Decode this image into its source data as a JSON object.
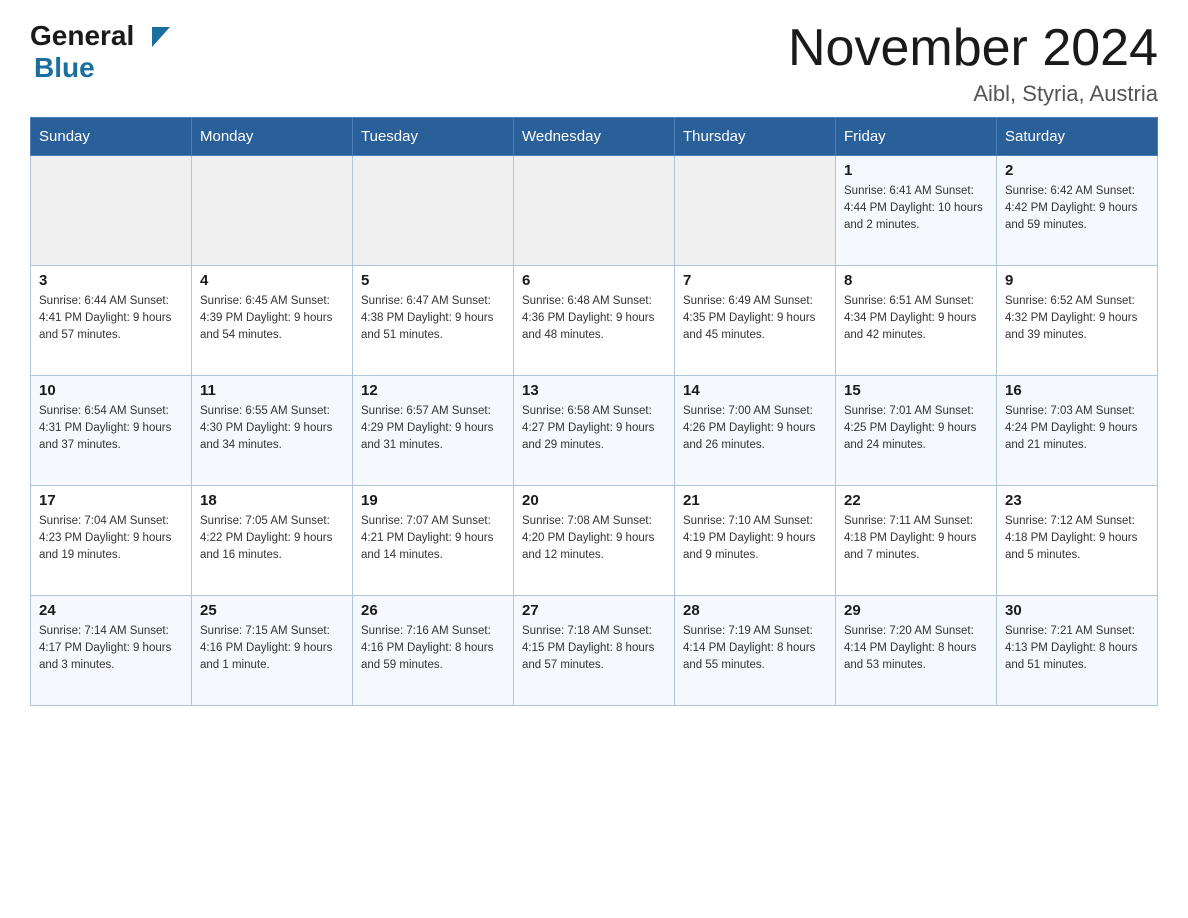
{
  "header": {
    "logo_general": "General",
    "logo_blue": "Blue",
    "title": "November 2024",
    "subtitle": "Aibl, Styria, Austria"
  },
  "weekdays": [
    "Sunday",
    "Monday",
    "Tuesday",
    "Wednesday",
    "Thursday",
    "Friday",
    "Saturday"
  ],
  "weeks": [
    [
      {
        "day": "",
        "info": ""
      },
      {
        "day": "",
        "info": ""
      },
      {
        "day": "",
        "info": ""
      },
      {
        "day": "",
        "info": ""
      },
      {
        "day": "",
        "info": ""
      },
      {
        "day": "1",
        "info": "Sunrise: 6:41 AM\nSunset: 4:44 PM\nDaylight: 10 hours\nand 2 minutes."
      },
      {
        "day": "2",
        "info": "Sunrise: 6:42 AM\nSunset: 4:42 PM\nDaylight: 9 hours\nand 59 minutes."
      }
    ],
    [
      {
        "day": "3",
        "info": "Sunrise: 6:44 AM\nSunset: 4:41 PM\nDaylight: 9 hours\nand 57 minutes."
      },
      {
        "day": "4",
        "info": "Sunrise: 6:45 AM\nSunset: 4:39 PM\nDaylight: 9 hours\nand 54 minutes."
      },
      {
        "day": "5",
        "info": "Sunrise: 6:47 AM\nSunset: 4:38 PM\nDaylight: 9 hours\nand 51 minutes."
      },
      {
        "day": "6",
        "info": "Sunrise: 6:48 AM\nSunset: 4:36 PM\nDaylight: 9 hours\nand 48 minutes."
      },
      {
        "day": "7",
        "info": "Sunrise: 6:49 AM\nSunset: 4:35 PM\nDaylight: 9 hours\nand 45 minutes."
      },
      {
        "day": "8",
        "info": "Sunrise: 6:51 AM\nSunset: 4:34 PM\nDaylight: 9 hours\nand 42 minutes."
      },
      {
        "day": "9",
        "info": "Sunrise: 6:52 AM\nSunset: 4:32 PM\nDaylight: 9 hours\nand 39 minutes."
      }
    ],
    [
      {
        "day": "10",
        "info": "Sunrise: 6:54 AM\nSunset: 4:31 PM\nDaylight: 9 hours\nand 37 minutes."
      },
      {
        "day": "11",
        "info": "Sunrise: 6:55 AM\nSunset: 4:30 PM\nDaylight: 9 hours\nand 34 minutes."
      },
      {
        "day": "12",
        "info": "Sunrise: 6:57 AM\nSunset: 4:29 PM\nDaylight: 9 hours\nand 31 minutes."
      },
      {
        "day": "13",
        "info": "Sunrise: 6:58 AM\nSunset: 4:27 PM\nDaylight: 9 hours\nand 29 minutes."
      },
      {
        "day": "14",
        "info": "Sunrise: 7:00 AM\nSunset: 4:26 PM\nDaylight: 9 hours\nand 26 minutes."
      },
      {
        "day": "15",
        "info": "Sunrise: 7:01 AM\nSunset: 4:25 PM\nDaylight: 9 hours\nand 24 minutes."
      },
      {
        "day": "16",
        "info": "Sunrise: 7:03 AM\nSunset: 4:24 PM\nDaylight: 9 hours\nand 21 minutes."
      }
    ],
    [
      {
        "day": "17",
        "info": "Sunrise: 7:04 AM\nSunset: 4:23 PM\nDaylight: 9 hours\nand 19 minutes."
      },
      {
        "day": "18",
        "info": "Sunrise: 7:05 AM\nSunset: 4:22 PM\nDaylight: 9 hours\nand 16 minutes."
      },
      {
        "day": "19",
        "info": "Sunrise: 7:07 AM\nSunset: 4:21 PM\nDaylight: 9 hours\nand 14 minutes."
      },
      {
        "day": "20",
        "info": "Sunrise: 7:08 AM\nSunset: 4:20 PM\nDaylight: 9 hours\nand 12 minutes."
      },
      {
        "day": "21",
        "info": "Sunrise: 7:10 AM\nSunset: 4:19 PM\nDaylight: 9 hours\nand 9 minutes."
      },
      {
        "day": "22",
        "info": "Sunrise: 7:11 AM\nSunset: 4:18 PM\nDaylight: 9 hours\nand 7 minutes."
      },
      {
        "day": "23",
        "info": "Sunrise: 7:12 AM\nSunset: 4:18 PM\nDaylight: 9 hours\nand 5 minutes."
      }
    ],
    [
      {
        "day": "24",
        "info": "Sunrise: 7:14 AM\nSunset: 4:17 PM\nDaylight: 9 hours\nand 3 minutes."
      },
      {
        "day": "25",
        "info": "Sunrise: 7:15 AM\nSunset: 4:16 PM\nDaylight: 9 hours\nand 1 minute."
      },
      {
        "day": "26",
        "info": "Sunrise: 7:16 AM\nSunset: 4:16 PM\nDaylight: 8 hours\nand 59 minutes."
      },
      {
        "day": "27",
        "info": "Sunrise: 7:18 AM\nSunset: 4:15 PM\nDaylight: 8 hours\nand 57 minutes."
      },
      {
        "day": "28",
        "info": "Sunrise: 7:19 AM\nSunset: 4:14 PM\nDaylight: 8 hours\nand 55 minutes."
      },
      {
        "day": "29",
        "info": "Sunrise: 7:20 AM\nSunset: 4:14 PM\nDaylight: 8 hours\nand 53 minutes."
      },
      {
        "day": "30",
        "info": "Sunrise: 7:21 AM\nSunset: 4:13 PM\nDaylight: 8 hours\nand 51 minutes."
      }
    ]
  ]
}
